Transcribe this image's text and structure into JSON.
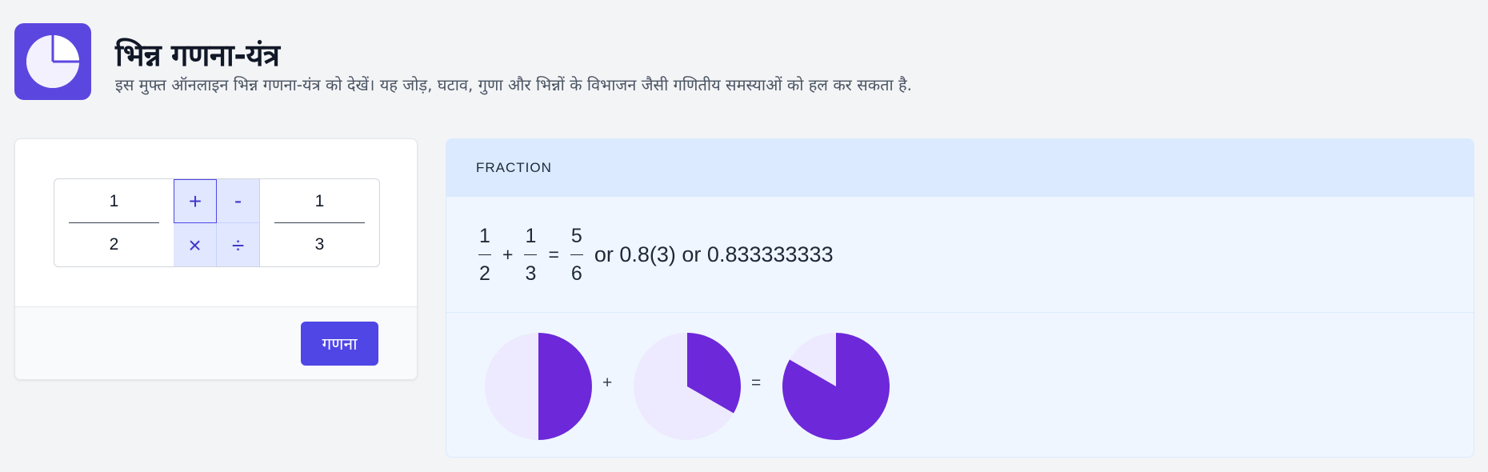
{
  "header": {
    "title": "भिन्न गणना-यंत्र",
    "subtitle": "इस मुफ्त ऑनलाइन भिन्न गणना-यंत्र को देखें। यह जोड़, घटाव, गुणा और भिन्नों के विभाजन जैसी गणितीय समस्याओं को हल कर सकता है."
  },
  "calculator": {
    "fraction1": {
      "numerator": "1",
      "denominator": "2"
    },
    "fraction2": {
      "numerator": "1",
      "denominator": "3"
    },
    "operators": {
      "add": "+",
      "subtract": "-",
      "multiply": "×",
      "divide": "÷"
    },
    "selected_operator": "+",
    "calculate_label": "गणना"
  },
  "result": {
    "header": "FRACTION",
    "f1": {
      "n": "1",
      "d": "2"
    },
    "op": "+",
    "f2": {
      "n": "1",
      "d": "3"
    },
    "equals": "=",
    "res": {
      "n": "5",
      "d": "6"
    },
    "alt_text": "or 0.8(3) or 0.833333333",
    "pie_plus": "+",
    "pie_equals": "=",
    "pie_fractions": [
      0.5,
      0.3333333,
      0.8333333
    ]
  },
  "colors": {
    "accent": "#4f46e5",
    "pie_fill": "#6d28d9",
    "pie_bg": "#ede9fe"
  }
}
